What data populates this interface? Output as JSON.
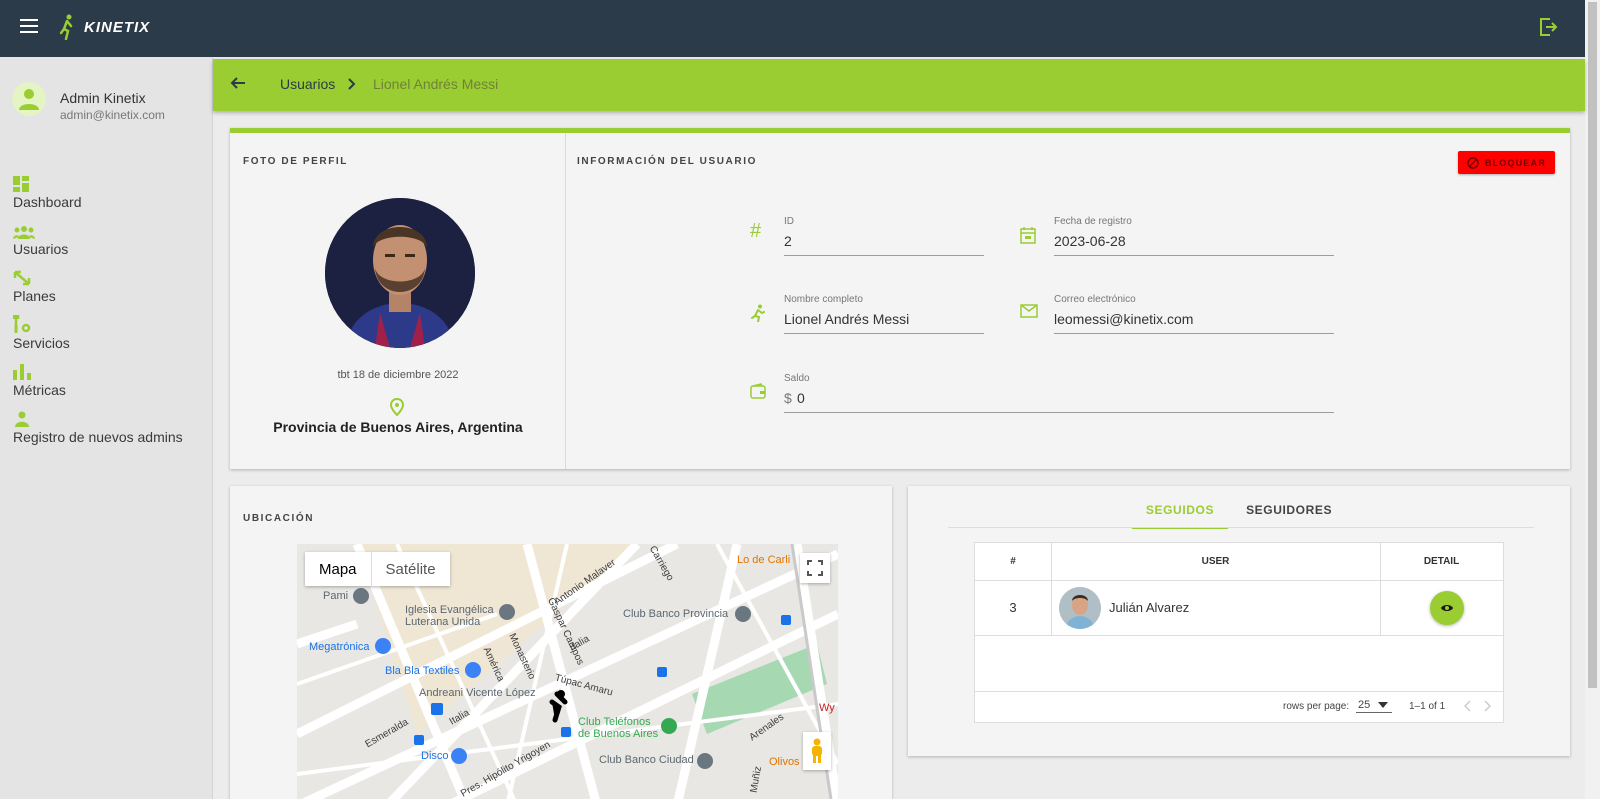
{
  "app": {
    "brand": "KINETIX"
  },
  "user": {
    "name": "Admin Kinetix",
    "email": "admin@kinetix.com"
  },
  "nav": [
    {
      "label": "Dashboard",
      "icon": "dashboard-icon"
    },
    {
      "label": "Usuarios",
      "icon": "people-icon"
    },
    {
      "label": "Planes",
      "icon": "expand-icon"
    },
    {
      "label": "Servicios",
      "icon": "tools-icon"
    },
    {
      "label": "Métricas",
      "icon": "bar-chart-icon"
    },
    {
      "label": "Registro de nuevos admins",
      "icon": "admin-add-icon"
    }
  ],
  "breadcrumb": {
    "parent": "Usuarios",
    "current": "Lionel Andrés Messi"
  },
  "profile": {
    "photo_title": "FOTO DE PERFIL",
    "photo_caption": "tbt 18 de diciembre 2022",
    "location": "Provincia de Buenos Aires, Argentina"
  },
  "info": {
    "title": "INFORMACIÓN DEL USUARIO",
    "block_label": "BLOQUEAR",
    "id_label": "ID",
    "id_value": "2",
    "date_label": "Fecha de registro",
    "date_value": "2023-06-28",
    "name_label": "Nombre completo",
    "name_value": "Lionel Andrés Messi",
    "email_label": "Correo electrónico",
    "email_value": "leomessi@kinetix.com",
    "balance_label": "Saldo",
    "balance_currency": "$",
    "balance_value": "0"
  },
  "location_card": {
    "title": "UBICACIÓN",
    "map_tab_map": "Mapa",
    "map_tab_satellite": "Satélite",
    "places": {
      "pami": "Pami",
      "iglesia": "Iglesia Evangélica\nLuterana Unida",
      "megatronica": "Megatrónica",
      "blabla": "Bla Bla Textiles",
      "andreani": "Andreani Vicente López",
      "banco_prov": "Club Banco Provincia",
      "telefonos": "Club Teléfonos\nde Buenos Aires",
      "disco": "Disco",
      "banco_ciudad": "Club Banco Ciudad",
      "lo_de_carli": "Lo de Carli",
      "olivos": "Olivos - Vice",
      "wy": "Wy"
    },
    "streets": {
      "antonio_malaver": "Antonio Malaver",
      "carriego": "Carriego",
      "gaspar_campos": "Gaspar Campos",
      "italia": "Italia",
      "monasterio": "Monasterio",
      "america": "América",
      "tupac": "Túpac Amaru",
      "esmeralda": "Esmeralda",
      "hipolito": "Pres. Hipólito Yrigoyen",
      "arenales": "Arenales",
      "muniz": "Muñiz"
    }
  },
  "follow": {
    "tab_following": "SEGUIDOS",
    "tab_followers": "SEGUIDORES",
    "columns": [
      "#",
      "USER",
      "DETAIL"
    ],
    "rows": [
      {
        "id": "3",
        "name": "Julián Alvarez"
      }
    ],
    "rows_per_page_label": "rows per page:",
    "rows_per_page": "25",
    "range": "1–1 of 1"
  },
  "colors": {
    "accent": "#9acd32",
    "topbar": "#2b3b49",
    "danger": "#ff0000"
  }
}
